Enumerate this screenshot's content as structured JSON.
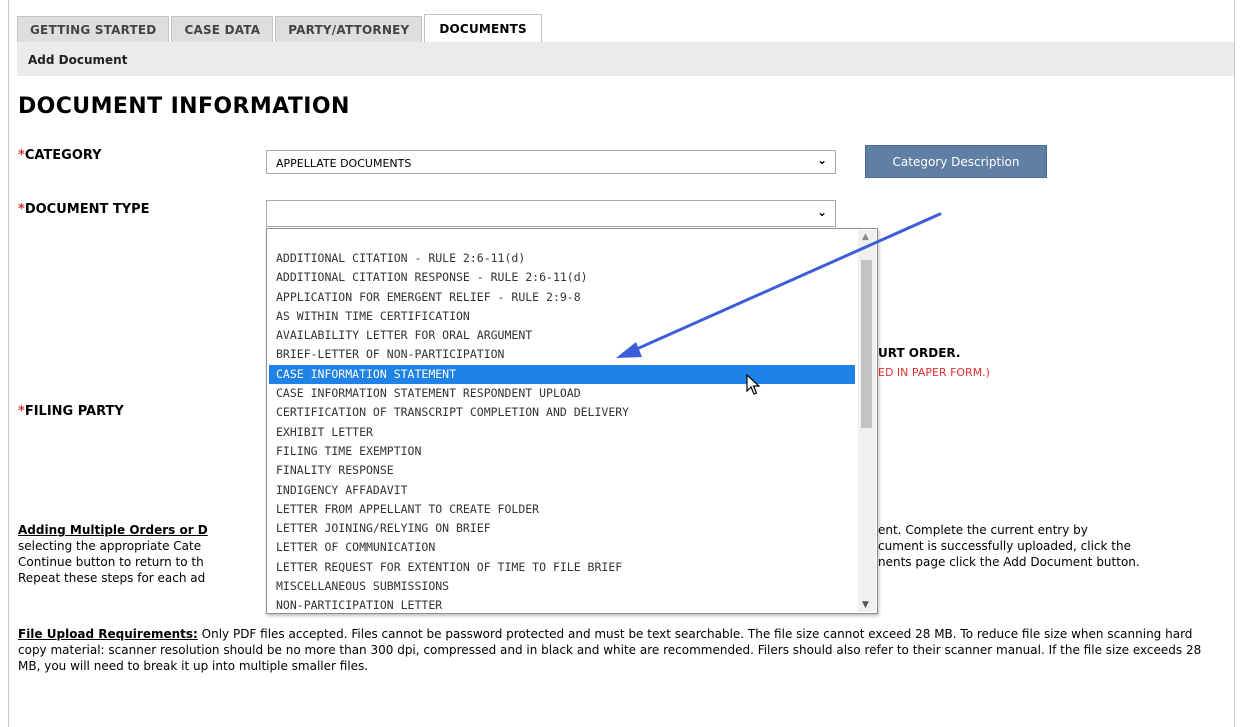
{
  "tabs": [
    "GETTING STARTED",
    "CASE DATA",
    "PARTY/ATTORNEY",
    "DOCUMENTS"
  ],
  "subnav": {
    "label": "Add Document"
  },
  "page_title": "DOCUMENT INFORMATION",
  "fields": {
    "required_marker": "*",
    "category_label": "CATEGORY",
    "category_value": "APPELLATE DOCUMENTS",
    "category_button": "Category Description",
    "doctype_label": "DOCUMENT TYPE",
    "doctype_value": "",
    "filing_party_label": "FILING PARTY"
  },
  "partially_hidden": {
    "court_order": "URT ORDER.",
    "paper_form": "ED IN PAPER FORM.)"
  },
  "dropdown": {
    "items": [
      "ADDITIONAL CITATION - RULE 2:6-11(d)",
      "ADDITIONAL CITATION RESPONSE - RULE 2:6-11(d)",
      "APPLICATION FOR EMERGENT RELIEF - RULE 2:9-8",
      "AS WITHIN TIME CERTIFICATION",
      "AVAILABILITY LETTER FOR ORAL ARGUMENT",
      "BRIEF-LETTER OF NON-PARTICIPATION",
      "CASE INFORMATION STATEMENT",
      "CASE INFORMATION STATEMENT RESPONDENT UPLOAD",
      "CERTIFICATION OF TRANSCRIPT COMPLETION AND DELIVERY",
      "EXHIBIT LETTER",
      "FILING TIME EXEMPTION",
      "FINALITY RESPONSE",
      "INDIGENCY AFFADAVIT",
      "LETTER FROM APPELLANT TO CREATE FOLDER",
      "LETTER JOINING/RELYING ON BRIEF",
      "LETTER OF COMMUNICATION",
      "LETTER REQUEST FOR EXTENTION OF TIME TO FILE BRIEF",
      "MISCELLANEOUS SUBMISSIONS",
      "NON-PARTICIPATION LETTER"
    ],
    "selected_index": 6
  },
  "multiple_orders": {
    "heading": "Adding Multiple Orders or D",
    "left_lines": [
      "selecting the appropriate Cate",
      "Continue button to return to th",
      "Repeat these steps for each ad"
    ],
    "right_lines": [
      "ent.  Complete the current entry by",
      "cument is successfully uploaded, click the",
      "nents page click the Add Document button."
    ]
  },
  "file_upload": {
    "heading": "File Upload Requirements:",
    "text": " Only PDF files accepted.  Files cannot be password protected and must be text searchable.  The file size cannot exceed 28 MB.  To reduce file size when scanning hard copy material: scanner resolution should be no more than 300 dpi, compressed and in black and white are recommended. Filers should also refer to their scanner manual. If the file size exceeds 28 MB, you will need to break it up into multiple smaller files."
  },
  "icons": {
    "dropdown_chevron": "chevron-down-icon",
    "cursor": "mouse-pointer-icon",
    "annotation": "annotation-arrow-icon"
  },
  "colors": {
    "button_bg": "#5f7fa4",
    "required": "#e03030",
    "selection": "#1e82e6",
    "arrow": "#3b5fd8"
  }
}
